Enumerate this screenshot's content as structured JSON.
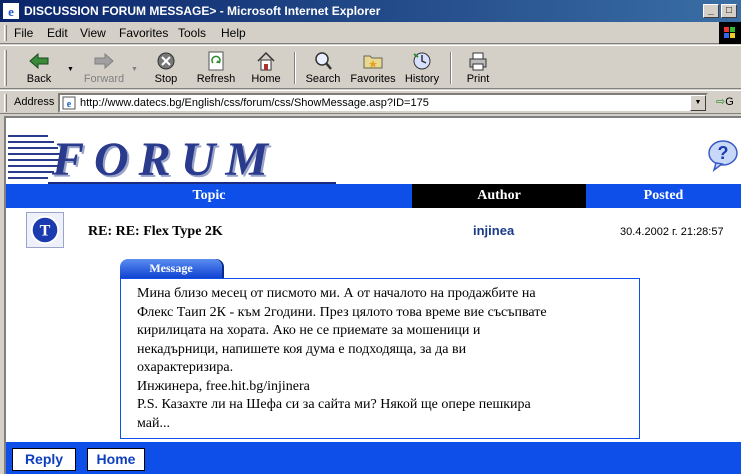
{
  "window": {
    "title": "DISCUSSION FORUM MESSAGE> - Microsoft Internet Explorer",
    "minimize": "_",
    "maximize": "□",
    "close": "×"
  },
  "menu": [
    {
      "label": "File"
    },
    {
      "label": "Edit"
    },
    {
      "label": "View"
    },
    {
      "label": "Favorites"
    },
    {
      "label": "Tools"
    },
    {
      "label": "Help"
    }
  ],
  "toolbar": {
    "back": "Back",
    "forward": "Forward",
    "stop": "Stop",
    "refresh": "Refresh",
    "home": "Home",
    "search": "Search",
    "favorites": "Favorites",
    "history": "History",
    "print": "Print"
  },
  "address": {
    "label": "Address",
    "url": "http://www.datecs.bg/English/css/forum/css/ShowMessage.asp?ID=175",
    "go": "G"
  },
  "forum": {
    "logo_text": "FORUM",
    "columns": {
      "topic": "Topic",
      "author": "Author",
      "posted": "Posted"
    },
    "post": {
      "avatar_letter": "T",
      "title": "RE: RE: Flex Type 2K",
      "author": "injinea",
      "date": "30.4.2002 г. 21:28:57"
    },
    "message_tab": "Message",
    "message_lines": [
      "Мина близо месец от писмото ми. А от началото на продажбите на",
      "Флекс Таип 2К - към 2години. През цялото това време вие съсъпвате",
      "кирилицата на хората. Ако не се приемате за мошеници и",
      "некадърници, напишете коя дума е подходяща, за да ви",
      "охарактеризира.",
      "Инжинера, free.hit.bg/injinera",
      "P.S. Казахте ли на Шефа си за сайта ми? Някой ще опере пешкира",
      "май..."
    ],
    "buttons": {
      "reply": "Reply",
      "home": "Home"
    }
  },
  "colors": {
    "accent": "#0d4fe8",
    "title_bar": "#0a246a",
    "logo": "#2a3a8c"
  }
}
